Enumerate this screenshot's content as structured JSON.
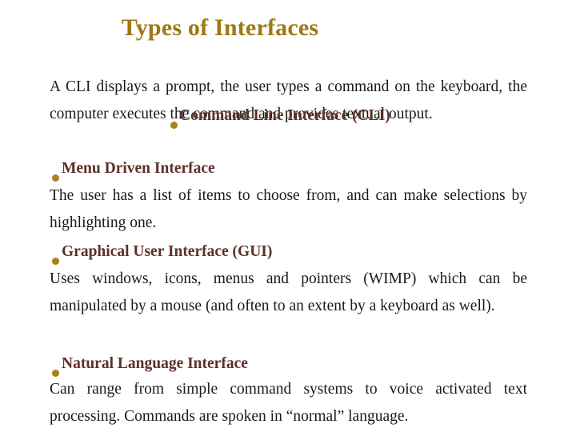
{
  "slide": {
    "title": "Types of Interfaces",
    "background_color": "#ffffff",
    "title_color": "#9d7813",
    "heading_color": "#5e2f29",
    "bullet_color": "#a8821a",
    "body_color": "#1a1a1a"
  },
  "sections": [
    {
      "id": "cli",
      "bullet": "•",
      "heading": "Command Line Interface (CLI)",
      "body": "A CLI displays a prompt, the user types a command on the keyboard, the computer executes the command and provides textual output."
    },
    {
      "id": "menu",
      "bullet": "•",
      "heading": "Menu Driven Interface",
      "body": "The user has a list of items to choose from, and can make selections by highlighting one."
    },
    {
      "id": "gui",
      "bullet": "•",
      "heading": "Graphical User Interface (GUI)",
      "body": "Uses windows, icons, menus and pointers (WIMP) which can be manipulated by a mouse (and often to an extent by a keyboard as well)."
    },
    {
      "id": "nl",
      "bullet": "•",
      "heading": "Natural Language Interface",
      "body": "Can range from simple command systems to voice activated text processing. Commands are spoken in “normal” language."
    }
  ]
}
